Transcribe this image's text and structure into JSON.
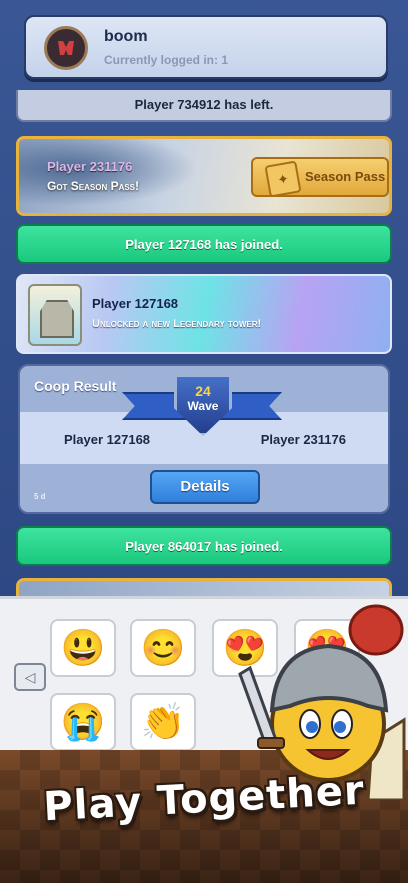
{
  "header": {
    "username": "boom",
    "status": "Currently logged in: 1"
  },
  "feed": {
    "left_message": "Player 734912 has left.",
    "season_pass": {
      "player": "Player 231176",
      "text": "Got Season Pass!",
      "button_label": "Season Pass"
    },
    "joined_1": "Player 127168 has joined.",
    "legendary": {
      "player": "Player 127168",
      "text": "Unlocked a new Legendary tower!"
    },
    "coop": {
      "title": "Coop Result",
      "wave_number": "24",
      "wave_label": "Wave",
      "player_left": "Player 127168",
      "player_right": "Player 231176",
      "age": "5 d",
      "details_label": "Details"
    },
    "joined_2": "Player 864017 has joined."
  },
  "emoji_panel": {
    "arrow": "◁",
    "emojis": [
      {
        "name": "knight-emoji",
        "glyph": "😃"
      },
      {
        "name": "princess-emoji",
        "glyph": "😊"
      },
      {
        "name": "fairy-emoji",
        "glyph": "😍"
      },
      {
        "name": "hearts-emoji",
        "glyph": "😍"
      },
      {
        "name": "crying-emoji",
        "glyph": "😭"
      },
      {
        "name": "clapping-emoji",
        "glyph": "👏"
      }
    ]
  },
  "banner": {
    "tagline": "Play Together"
  }
}
